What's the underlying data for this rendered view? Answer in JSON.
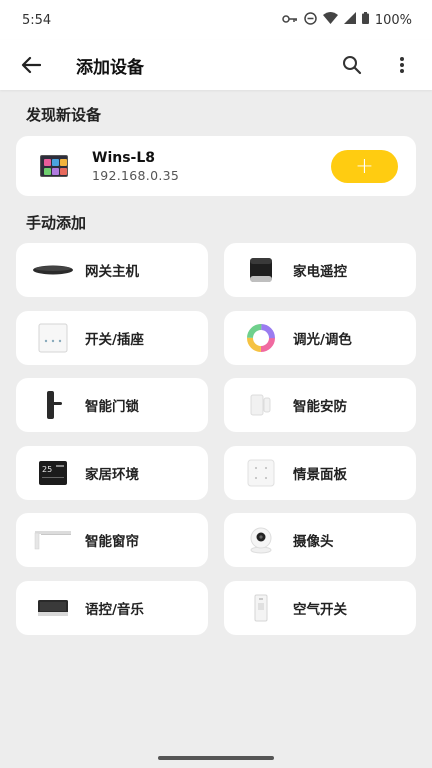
{
  "status": {
    "time": "5:54",
    "battery": "100%"
  },
  "header": {
    "title": "添加设备"
  },
  "discovered": {
    "section_title": "发现新设备",
    "device": {
      "name": "Wins-L8",
      "ip": "192.168.0.35"
    },
    "add_label": "+"
  },
  "manual": {
    "section_title": "手动添加",
    "items": [
      {
        "label": "网关主机",
        "icon": "gateway-icon"
      },
      {
        "label": "家电遥控",
        "icon": "ir-remote-icon"
      },
      {
        "label": "开关/插座",
        "icon": "switch-panel-icon"
      },
      {
        "label": "调光/调色",
        "icon": "color-ring-icon"
      },
      {
        "label": "智能门锁",
        "icon": "door-lock-icon"
      },
      {
        "label": "智能安防",
        "icon": "security-sensor-icon"
      },
      {
        "label": "家居环境",
        "icon": "thermostat-icon"
      },
      {
        "label": "情景面板",
        "icon": "scene-panel-icon"
      },
      {
        "label": "智能窗帘",
        "icon": "curtain-icon"
      },
      {
        "label": "摄像头",
        "icon": "camera-icon"
      },
      {
        "label": "语控/音乐",
        "icon": "voice-music-panel-icon"
      },
      {
        "label": "空气开关",
        "icon": "circuit-breaker-icon"
      }
    ]
  },
  "colors": {
    "accent": "#ffcc11",
    "background": "#ededed",
    "card": "#ffffff"
  }
}
